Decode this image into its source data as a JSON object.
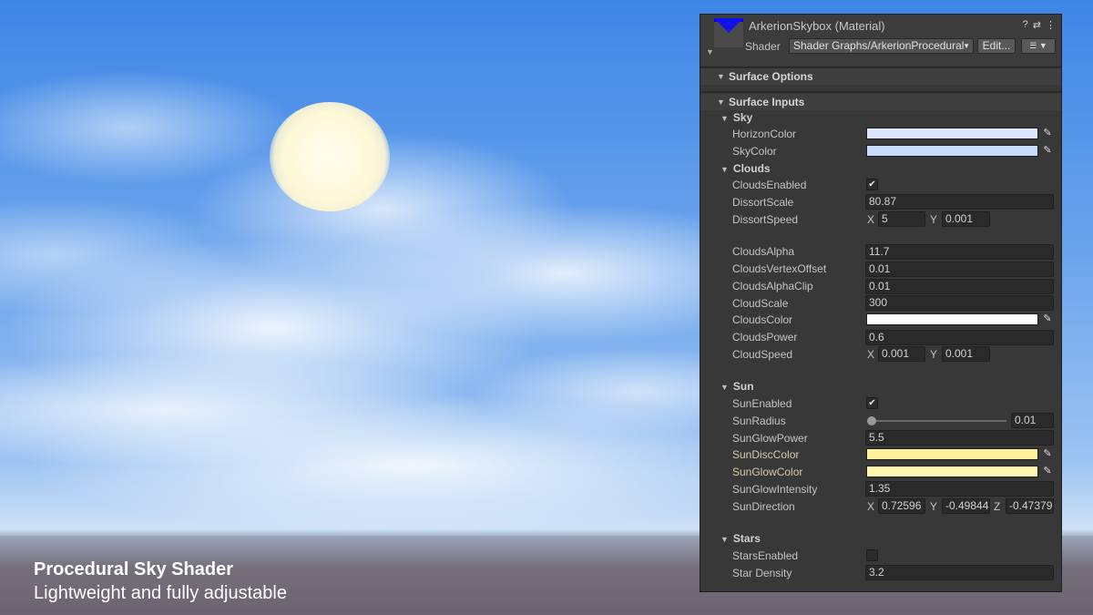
{
  "material": {
    "title": "ArkerionSkybox (Material)",
    "shader_label": "Shader",
    "shader_value": "Shader Graphs/ArkerionProcedural",
    "edit_label": "Edit...",
    "icons": [
      "help-icon",
      "presets-icon",
      "more-vertical-icon"
    ],
    "thumbnail_color": "#0000ff"
  },
  "groups": {
    "surface_options": "Surface Options",
    "surface_inputs": "Surface Inputs"
  },
  "sky": {
    "label": "Sky",
    "horizon_color": {
      "label": "HorizonColor",
      "color": "#dde6ff"
    },
    "sky_color": {
      "label": "SkyColor",
      "color": "#c9dcff"
    }
  },
  "clouds": {
    "label": "Clouds",
    "enabled": {
      "label": "CloudsEnabled",
      "checked": true,
      "mark": "✔"
    },
    "dissort_scale": {
      "label": "DissortScale",
      "value": "80.87"
    },
    "dissort_speed": {
      "label": "DissortSpeed",
      "x_label": "X",
      "x": "5",
      "y_label": "Y",
      "y": "0.001"
    },
    "alpha": {
      "label": "CloudsAlpha",
      "value": "11.7"
    },
    "vertex_offset": {
      "label": "CloudsVertexOffset",
      "value": "0.01"
    },
    "alpha_clip": {
      "label": "CloudsAlphaClip",
      "value": "0.01"
    },
    "scale": {
      "label": "CloudScale",
      "value": "300"
    },
    "color": {
      "label": "CloudsColor",
      "color": "#ffffff"
    },
    "power": {
      "label": "CloudsPower",
      "value": "0.6"
    },
    "speed": {
      "label": "CloudSpeed",
      "x_label": "X",
      "x": "0.001",
      "y_label": "Y",
      "y": "0.001"
    }
  },
  "sun": {
    "label": "Sun",
    "enabled": {
      "label": "SunEnabled",
      "checked": true,
      "mark": "✔"
    },
    "radius": {
      "label": "SunRadius",
      "value": "0.01",
      "slider_fraction": 0.0
    },
    "glow_power": {
      "label": "SunGlowPower",
      "value": "5.5"
    },
    "disc_color": {
      "label": "SunDiscColor",
      "color": "#fff29a"
    },
    "glow_color": {
      "label": "SunGlowColor",
      "color": "#fff6b0"
    },
    "glow_intensity": {
      "label": "SunGlowIntensity",
      "value": "1.35"
    },
    "direction": {
      "label": "SunDirection",
      "x_label": "X",
      "x": "0.72596",
      "y_label": "Y",
      "y": "-0.49844",
      "z_label": "Z",
      "z": "-0.47379"
    }
  },
  "stars": {
    "label": "Stars",
    "enabled": {
      "label": "StarsEnabled",
      "checked": false,
      "mark": ""
    },
    "density": {
      "label": "Star Density",
      "value": "3.2"
    }
  },
  "caption": {
    "title": "Procedural Sky Shader",
    "subtitle": "Lightweight and fully adjustable"
  }
}
